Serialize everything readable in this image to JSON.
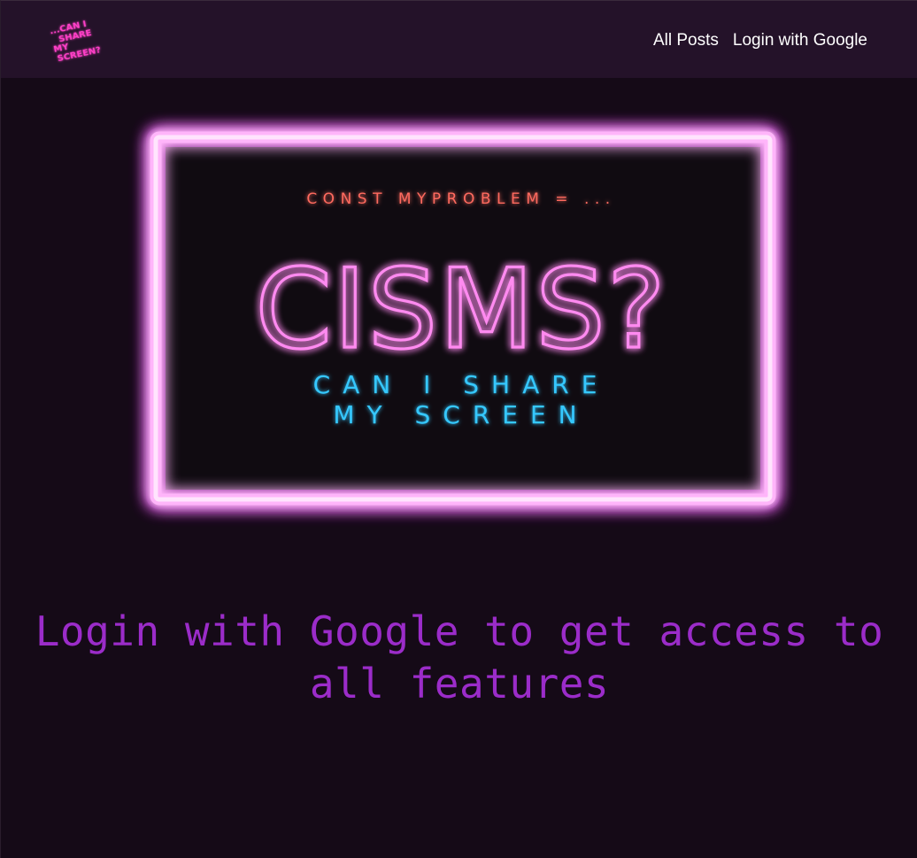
{
  "logo": {
    "line1": "...CAN I",
    "line2": "SHARE",
    "line3": "MY",
    "line4": "SCREEN?",
    "color": "#ff3fc8"
  },
  "nav": {
    "all_posts": "All Posts",
    "login": "Login with Google"
  },
  "hero": {
    "tagline": "CONST MYPROBLEM = ...",
    "wordmark": "CISMS?",
    "subtitle_line1": "CAN I SHARE",
    "subtitle_line2": "MY SCREEN",
    "frame_color": "#ff4cf0",
    "tagline_color": "#ff6a5e",
    "wordmark_color": "#ff8af0",
    "subtitle_color": "#35c8ff"
  },
  "main": {
    "login_prompt": "Login with Google to get access to all features"
  },
  "colors": {
    "background": "#150a17",
    "navbar": "#241229",
    "prompt_text": "#9b2cc9"
  }
}
